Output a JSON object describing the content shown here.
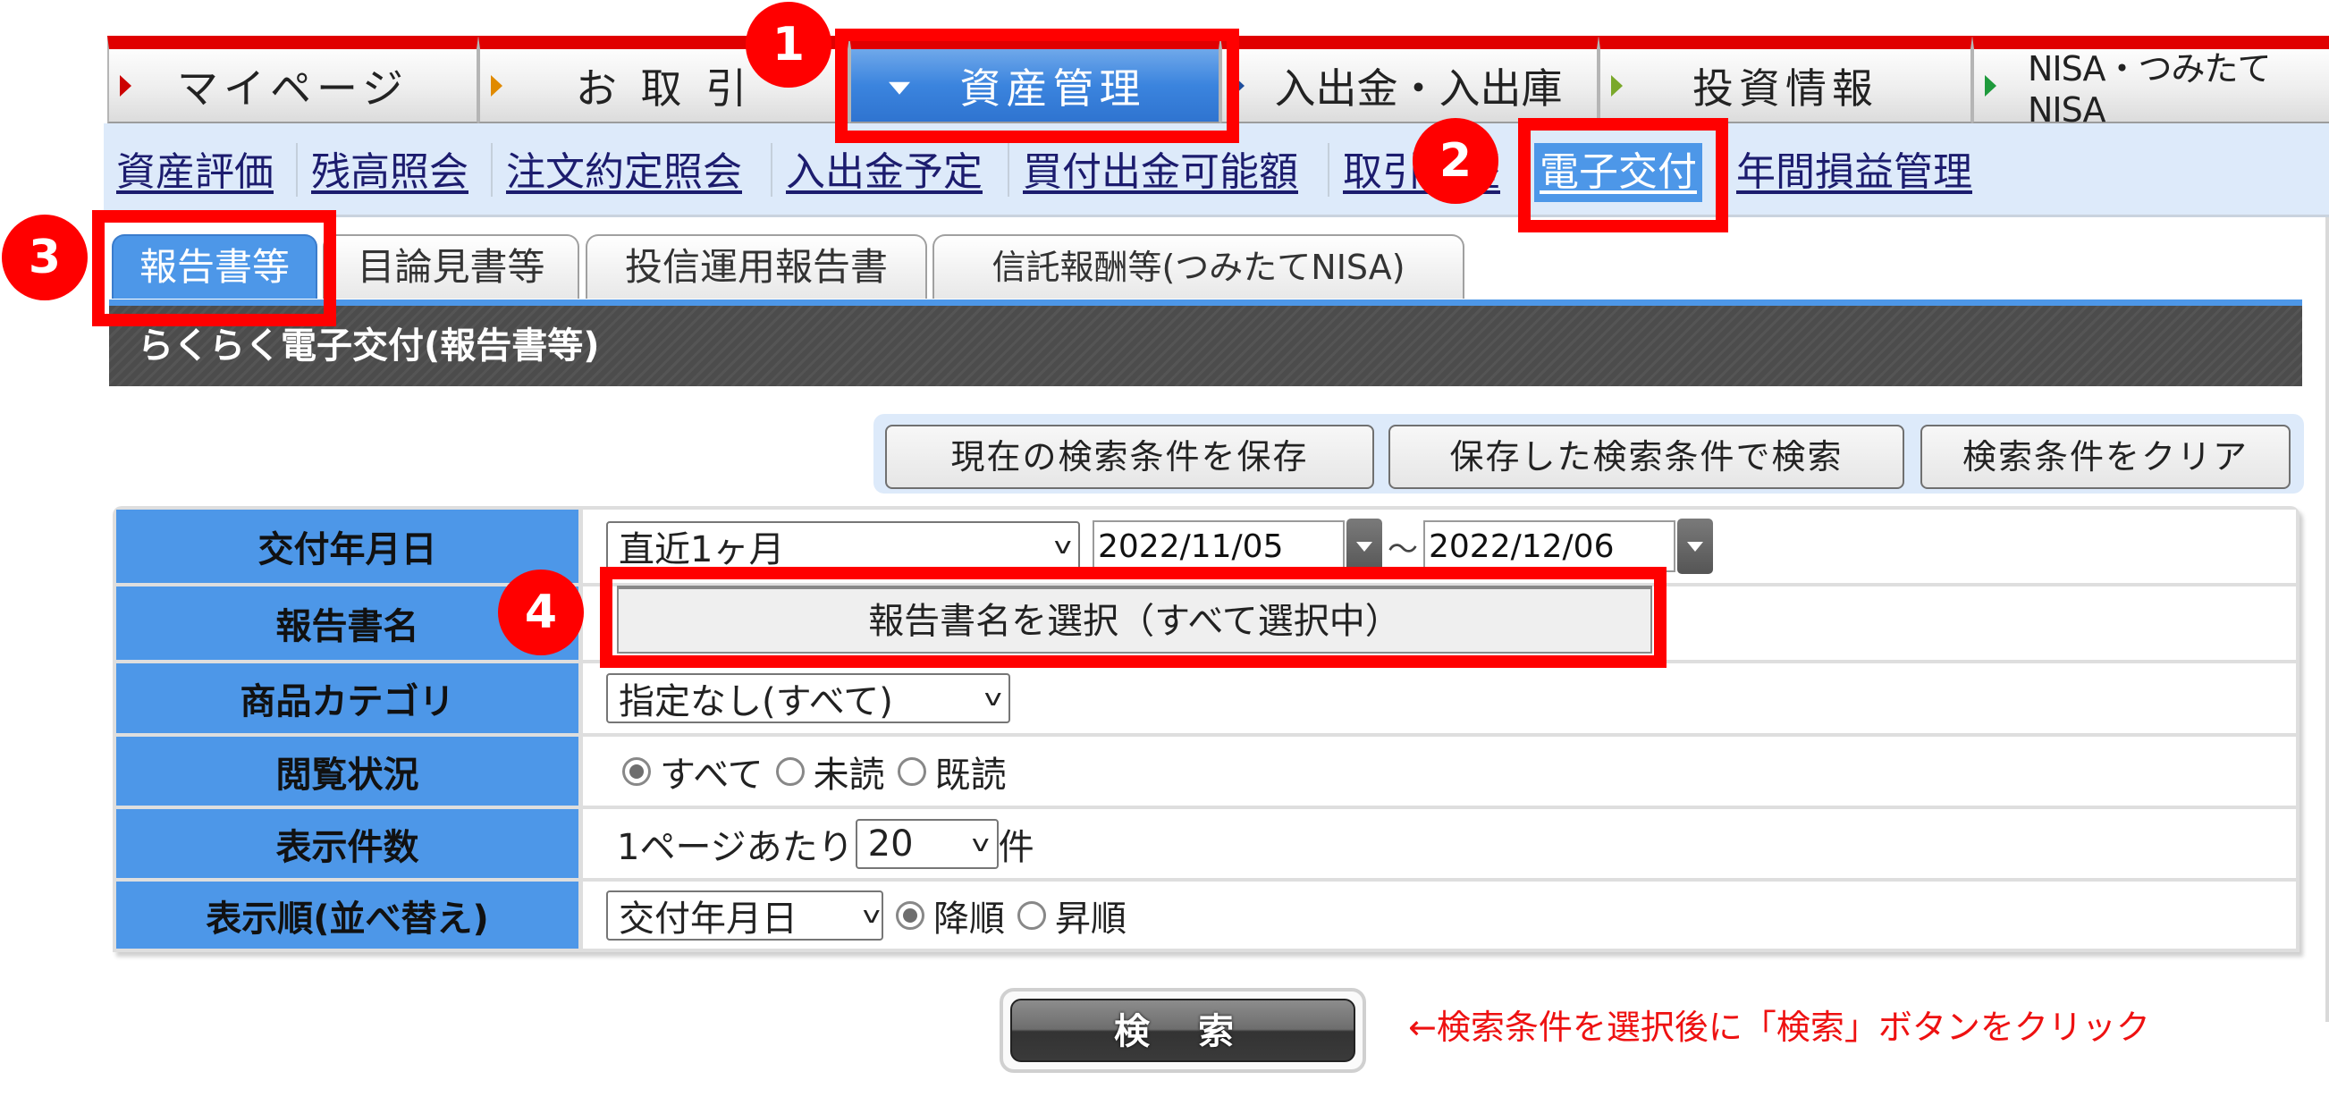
{
  "global_nav": {
    "items": [
      {
        "label": "マイページ",
        "arrow_color": "#cc0000",
        "active": false
      },
      {
        "label": "お 取 引",
        "arrow_color": "#e08a00",
        "active": false
      },
      {
        "label": "資産管理",
        "arrow_color": "#ffffff",
        "active": true
      },
      {
        "label": "入出金・入出庫",
        "arrow_color": "#1f4e9c",
        "active": false
      },
      {
        "label": "投資情報",
        "arrow_color": "#7aa82a",
        "active": false
      },
      {
        "label": "NISA・つみたてNISA",
        "arrow_color": "#1e9a3c",
        "active": false
      }
    ]
  },
  "sub_nav": {
    "items": [
      {
        "label": "資産評価"
      },
      {
        "label": "残高照会"
      },
      {
        "label": "注文約定照会"
      },
      {
        "label": "入出金予定"
      },
      {
        "label": "買付出金可能額"
      },
      {
        "label": "取引履歴"
      },
      {
        "label": "電子交付",
        "active": true
      },
      {
        "label": "年間損益管理"
      }
    ]
  },
  "doc_tabs": {
    "items": [
      {
        "label": "報告書等",
        "active": true
      },
      {
        "label": "目論見書等"
      },
      {
        "label": "投信運用報告書"
      },
      {
        "label": "信託報酬等(つみたてNISA)"
      }
    ]
  },
  "section_title": "らくらく電子交付(報告書等)",
  "actions": {
    "save": "現在の検索条件を保存",
    "load": "保存した検索条件で検索",
    "clear": "検索条件をクリア"
  },
  "form": {
    "rows": [
      {
        "label": "交付年月日"
      },
      {
        "label": "報告書名"
      },
      {
        "label": "商品カテゴリ"
      },
      {
        "label": "閲覧状況"
      },
      {
        "label": "表示件数"
      },
      {
        "label": "表示順(並べ替え)"
      }
    ],
    "date_period": {
      "value": "直近1ヶ月"
    },
    "date_from": "2022/11/05",
    "date_separator": "～",
    "date_to": "2022/12/06",
    "report_select_button": "報告書名を選択（すべて選択中）",
    "category": {
      "value": "指定なし(すべて)"
    },
    "read_status": {
      "options": [
        "すべて",
        "未読",
        "既読"
      ],
      "selected": "すべて"
    },
    "per_page": {
      "prefix": "1ページあたり",
      "value": "20",
      "suffix": "件"
    },
    "sort": {
      "field": "交付年月日",
      "order_options": [
        "降順",
        "昇順"
      ],
      "selected": "降順"
    }
  },
  "search": {
    "button": "検 索",
    "note": "←検索条件を選択後に「検索」ボタンをクリック"
  },
  "annotations": {
    "steps": [
      "1",
      "2",
      "3",
      "4"
    ],
    "highlight_color": "#ff0000"
  },
  "colors": {
    "accent_blue": "#4d97e8",
    "nav_red": "#e00000",
    "subnav_bg": "#ddeafa",
    "link": "#1c1c6e"
  }
}
